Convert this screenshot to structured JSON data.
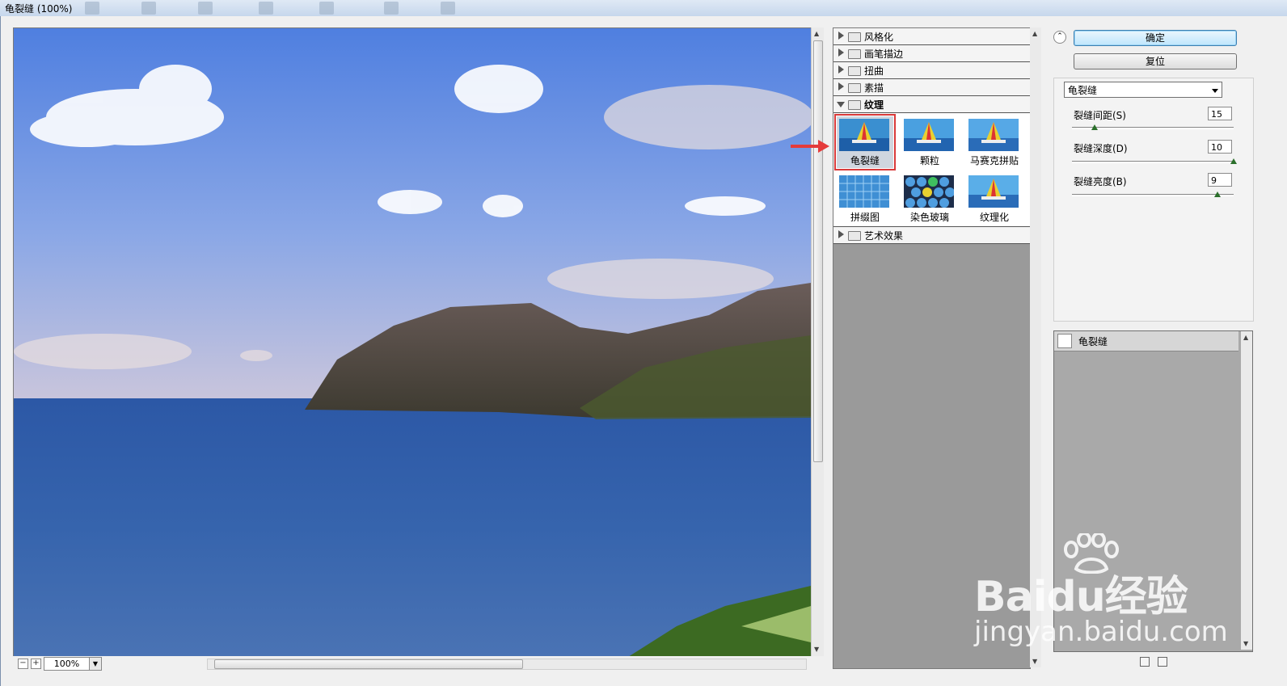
{
  "window": {
    "title": "龟裂缝 (100%)"
  },
  "preview": {
    "zoom": "100%"
  },
  "gallery": {
    "categories_top": [
      "风格化",
      "画笔描边",
      "扭曲",
      "素描"
    ],
    "open_category": "纹理",
    "filters": [
      "龟裂缝",
      "颗粒",
      "马赛克拼贴",
      "拼缀图",
      "染色玻璃",
      "纹理化"
    ],
    "selected_filter": "龟裂缝",
    "categories_bottom": [
      "艺术效果"
    ]
  },
  "buttons": {
    "ok": "确定",
    "reset": "复位"
  },
  "settings": {
    "filter_select": "龟裂缝",
    "params": [
      {
        "label": "裂缝间距(S)",
        "value": "15",
        "fraction": 0.14
      },
      {
        "label": "裂缝深度(D)",
        "value": "10",
        "fraction": 1.0
      },
      {
        "label": "裂缝亮度(B)",
        "value": "9",
        "fraction": 0.9
      }
    ]
  },
  "layers": {
    "items": [
      "龟裂缝"
    ]
  },
  "watermark": {
    "brand": "Baidu经验",
    "url": "jingyan.baidu.com"
  },
  "colors": {
    "accent_red": "#d93a3a",
    "sky": "#6a8fd8",
    "sea": "#2f5ea8"
  }
}
